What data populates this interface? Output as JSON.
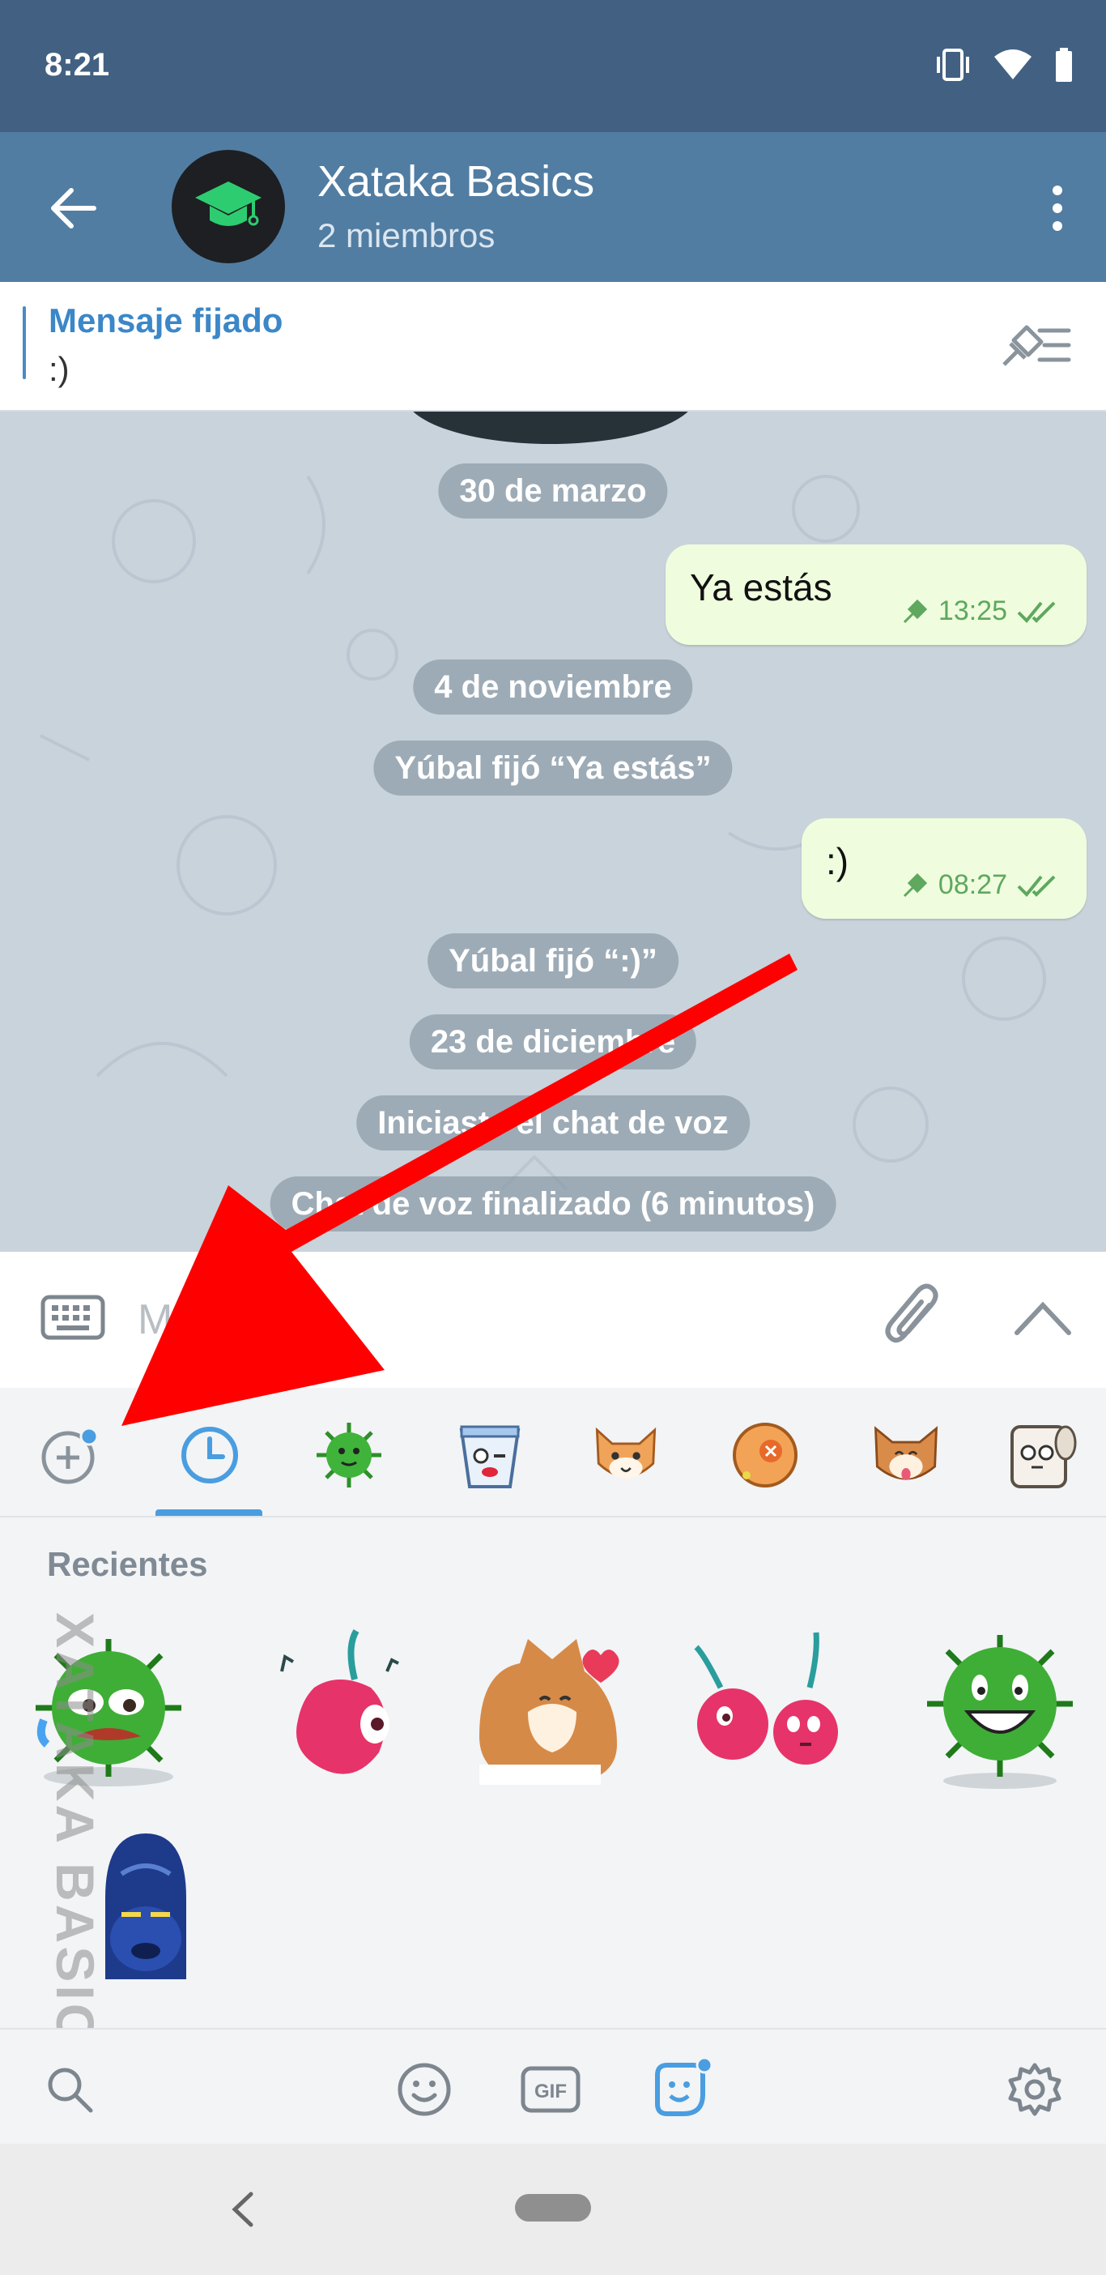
{
  "status_bar": {
    "time": "8:21",
    "icons": [
      "vibrate-icon",
      "wifi-icon",
      "battery-icon"
    ]
  },
  "header": {
    "title": "Xataka Basics",
    "subtitle": "2 miembros"
  },
  "pinned": {
    "title": "Mensaje fijado",
    "text": ":)"
  },
  "chat": {
    "date_1": "30 de marzo",
    "message_1": {
      "text": "Ya estás",
      "time": "13:25"
    },
    "date_2": "4 de noviembre",
    "service_1": "Yúbal fijó “Ya estás”",
    "message_2": {
      "text": ":)",
      "time": "08:27"
    },
    "service_2": "Yúbal fijó “:)”",
    "date_3": "23 de diciembre",
    "service_3": "Iniciaste el chat de voz",
    "service_4": "Chat de voz finalizado (6 minutos)"
  },
  "input": {
    "placeholder": "Mensaje"
  },
  "stickers": {
    "section_title": "Recientes",
    "tabs": [
      "add-pack",
      "recent",
      "virus",
      "cup",
      "cat",
      "shell",
      "dog",
      "toilet-paper"
    ]
  },
  "watermark": "XATAKA BASICS",
  "colors": {
    "header": "#517da2",
    "status": "#426182",
    "accent": "#4a9de0",
    "bubble": "#effdde",
    "arrow": "#ff0000"
  }
}
